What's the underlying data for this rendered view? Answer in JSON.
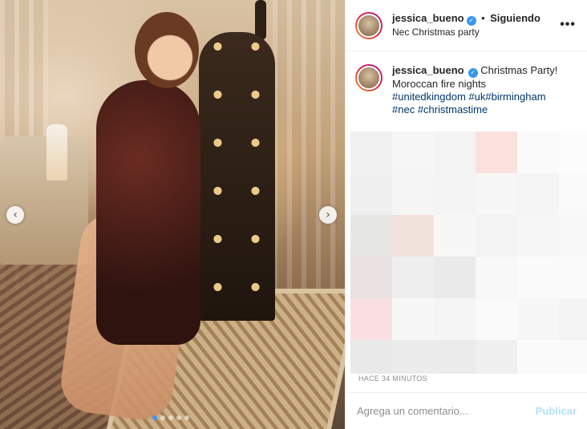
{
  "post": {
    "username": "jessica_bueno",
    "separator": "•",
    "follow_status": "Siguiendo",
    "location": "Nec Christmas party",
    "more_label": "•••",
    "caption_line1": "Christmas Party!",
    "caption_line2": "Moroccan fire nights",
    "hashtags_line1": [
      "#unitedkingdom",
      "#uk#birmingham"
    ],
    "hashtags_line2": [
      "#nec",
      "#christmastime"
    ],
    "timestamp": "HACE 34 MINUTOS"
  },
  "carousel": {
    "prev_label": "‹",
    "next_label": "›",
    "dot_count": 5,
    "active_index": 0
  },
  "comment_box": {
    "placeholder": "Agrega un comentario...",
    "publish_label": "Publicar"
  },
  "colors": {
    "accent": "#3897f0",
    "publish_disabled": "#b2dffc",
    "hashtag": "#00376b"
  },
  "blurred_tiles": [
    "#f1f1f1",
    "#f6f6f6",
    "#f3f3f3",
    "#fbe1de",
    "#fafafa",
    "#fcfcfc",
    "#f0f0f0",
    "#f5f5f5",
    "#f4f4f4",
    "#f7f7f7",
    "#f5f5f5",
    "#fafafa",
    "#e6e7e5",
    "#f2e2dc",
    "#f7f7f7",
    "#f3f3f3",
    "#f6f6f6",
    "#f8f8f8",
    "#eae2e2",
    "#eeeeee",
    "#eaeaea",
    "#f8f8f8",
    "#fbfbfb",
    "#fafafa",
    "#f9dfe2",
    "#f7f7f7",
    "#f5f5f5",
    "#fafafa",
    "#f7f7f7",
    "#f4f4f4",
    "#e9e9e9",
    "#ececec",
    "#ebebeb",
    "#f0f0f0",
    "#fbfbfb",
    "#fafafa"
  ]
}
